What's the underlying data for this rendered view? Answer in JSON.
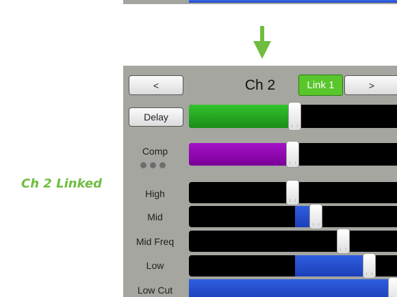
{
  "side_label": "Ch 2 Linked",
  "header": {
    "prev_label": "<",
    "title": "Ch 2",
    "link_label": "Link 1",
    "next_label": ">"
  },
  "rows": {
    "delay": {
      "label": "Delay",
      "level": 0.5,
      "color": "#2aad26"
    },
    "comp": {
      "label": "Comp",
      "level": 0.49,
      "color": "#9a10bd"
    },
    "high": {
      "label": "High",
      "level": 0.49
    },
    "mid": {
      "label": "Mid",
      "level": 0.6,
      "center": 0.5,
      "color": "#2a56d8"
    },
    "mid_freq": {
      "label": "Mid Freq",
      "level": 0.73
    },
    "low": {
      "label": "Low",
      "level": 0.85,
      "center": 0.5,
      "color": "#2a56d8"
    },
    "low_cut": {
      "label": "Low Cut",
      "level": 0.97,
      "color": "#2a56d8"
    }
  },
  "colors": {
    "panel": "#a4a69f",
    "link_active": "#59c62b",
    "side_label": "#6fbd3f",
    "arrow": "#6fbd3f"
  },
  "icons": {
    "arrow": "down-arrow-icon",
    "comp_more": "more-dots-icon"
  }
}
